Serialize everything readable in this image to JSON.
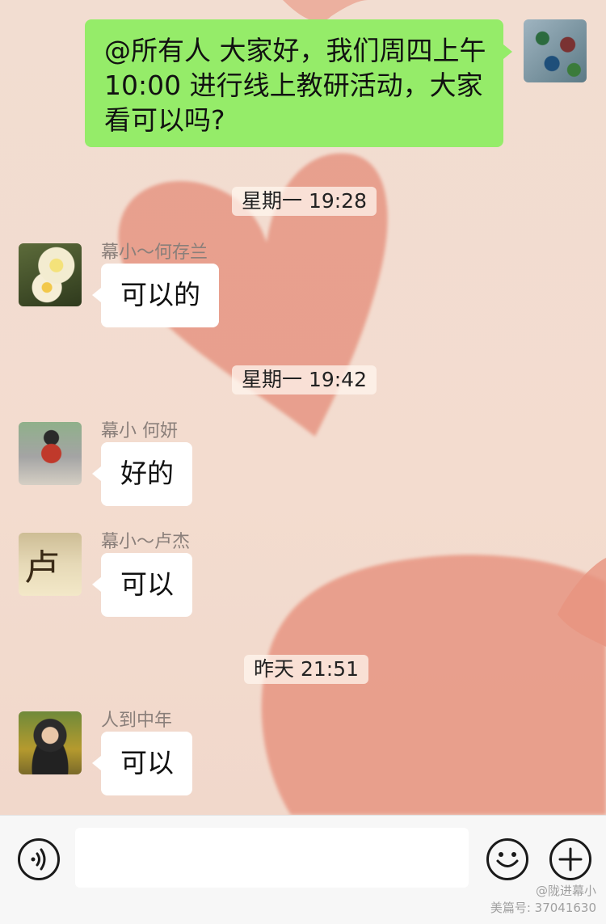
{
  "messages": [
    {
      "kind": "outgoing",
      "text_lines": [
        "@所有人 大家好，我们周四上午",
        "10:00 进行线上教研活动，大家",
        "看可以吗?"
      ]
    },
    {
      "kind": "timestamp",
      "text": "星期一 19:28"
    },
    {
      "kind": "incoming",
      "sender": "幕小～何存兰",
      "text": "可以的"
    },
    {
      "kind": "timestamp",
      "text": "星期一 19:42"
    },
    {
      "kind": "incoming",
      "sender": "幕小 何妍",
      "text": "好的"
    },
    {
      "kind": "incoming",
      "sender": "幕小～卢杰",
      "text": "可以"
    },
    {
      "kind": "timestamp",
      "text": "昨天 21:51"
    },
    {
      "kind": "incoming",
      "sender": "人到中年",
      "text": "可以"
    }
  ],
  "avatars": {
    "lujie_char": "卢"
  },
  "input_bar": {
    "placeholder": "",
    "voice_icon": "voice-icon",
    "emoji_icon": "emoji-icon",
    "plus_icon": "plus-icon"
  },
  "watermark": {
    "line1": "@陇进幕小",
    "line2": "美篇号: 37041630"
  },
  "colors": {
    "outgoing_bubble": "#95ec69",
    "incoming_bubble": "#ffffff",
    "background": "#f3ddd0",
    "heart": "#e6917f"
  }
}
